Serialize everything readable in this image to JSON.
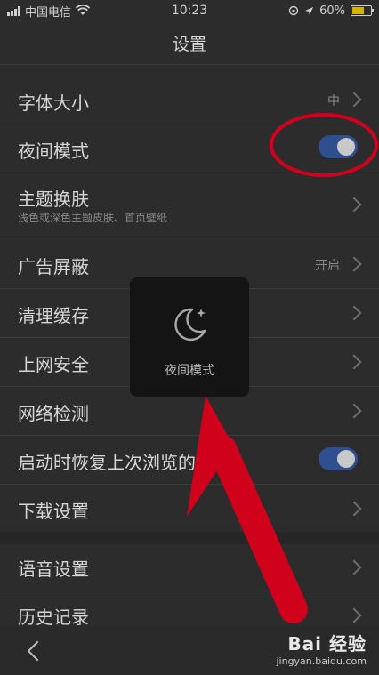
{
  "statusbar": {
    "carrier": "中国电信",
    "time": "10:23",
    "battery": "60%"
  },
  "header": {
    "title": "设置"
  },
  "settings": {
    "font_size": {
      "label": "字体大小",
      "value": "中"
    },
    "night_mode": {
      "label": "夜间模式",
      "enabled": true
    },
    "theme": {
      "label": "主题换肤",
      "subtitle": "浅色或深色主题皮肤、首页壁纸"
    },
    "ad_block": {
      "label": "广告屏蔽",
      "value": "开启"
    },
    "clear_cache": {
      "label": "清理缓存"
    },
    "web_security": {
      "label": "上网安全"
    },
    "network_check": {
      "label": "网络检测"
    },
    "restore_tabs": {
      "label": "启动时恢复上次浏览的网",
      "enabled": true
    },
    "download": {
      "label": "下载设置"
    },
    "voice": {
      "label": "语音设置"
    },
    "history": {
      "label": "历史记录"
    }
  },
  "toast": {
    "label": "夜间模式",
    "icon": "moon-icon"
  },
  "bottombar": {
    "back_icon": "chevron-left-icon"
  },
  "watermark": {
    "text": "Bai 经验",
    "url": "jingyan.baidu.com"
  },
  "colors": {
    "toggle_on": "#2f4f8e",
    "annotation": "#d0021b",
    "background": "#2c2c2c"
  }
}
